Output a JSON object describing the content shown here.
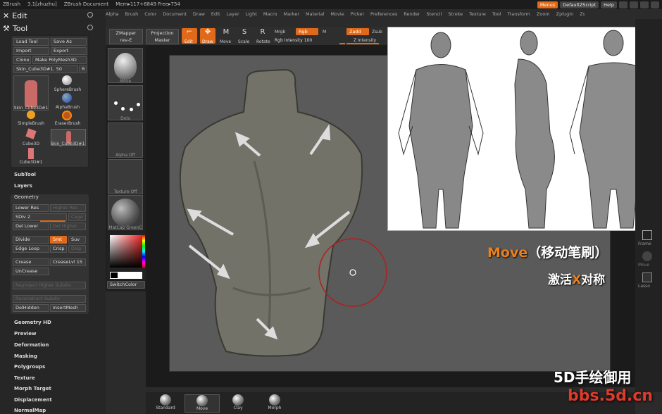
{
  "titlebar": {
    "app": "ZBrush",
    "version": "3.1[zhuzhu]",
    "doc": "ZBrush Document",
    "mem": "Mem▸117+6849 Free▸754"
  },
  "topright": {
    "menus": "Menus",
    "script": "DefaultZScript",
    "help": "Help"
  },
  "menubar": [
    "Alpha",
    "Brush",
    "Color",
    "Document",
    "Draw",
    "Edit",
    "Layer",
    "Light",
    "Macro",
    "Marker",
    "Material",
    "Movie",
    "Picker",
    "Preferences",
    "Render",
    "Stencil",
    "Stroke",
    "Texture",
    "Tool",
    "Transform",
    "Zoom",
    "Zplugin",
    "Zscript"
  ],
  "left": {
    "edit": "Edit",
    "tool": "Tool",
    "load_tool": "Load Tool",
    "save_as": "Save As",
    "import": "Import",
    "export": "Export",
    "clone": "Clone",
    "make_poly": "Make PolyMesh3D",
    "current": "Skin_Cube3D#1. 50",
    "r": "R",
    "thumbs": [
      "Skin_Cube3D#1",
      "SphereBrush",
      "AlphaBrush",
      "SimpleBrush",
      "EraserBrush",
      "Cube3D",
      "Skin_Cube3D#1",
      "Cube3D#1"
    ],
    "subtool": "SubTool",
    "layers": "Layers",
    "geometry": "Geometry",
    "lower_res": "Lower Res",
    "higher_res": "Higher Res",
    "sdiv": "SDiv 2",
    "cage": "Cage",
    "del_lower": "Del Lower",
    "del_higher": "Del Higher",
    "divide": "Divide",
    "smt": "Smt",
    "suv": "Suv",
    "edge_loop": "Edge Loop",
    "crisp": "Crisp",
    "disp": "Disp",
    "crease": "Crease",
    "crease_lvl": "CreaseLvl 15",
    "uncrease": "UnCrease",
    "reproject": "Reproject Higher Subdiv",
    "reconstruct": "Reconstruct Subdiv",
    "delhidden": "DelHidden",
    "insertmesh": "InsertMesh",
    "sections": [
      "Geometry HD",
      "Preview",
      "Deformation",
      "Masking",
      "Polygroups",
      "Texture",
      "Morph Target",
      "Displacement",
      "NormalMap"
    ]
  },
  "toolbar": {
    "zmapper": "ZMapper",
    "zmapper2": "rev-E",
    "projection": "Projection",
    "projection2": "Master",
    "edit": "Edit",
    "draw": "Draw",
    "move": "Move",
    "scale": "Scale",
    "rotate": "Rotate",
    "mrgb": "Mrgb",
    "rgb": "Rgb",
    "m": "M",
    "rgb_intensity": "Rgb Intensity 100",
    "zadd": "Zadd",
    "zsub": "Zsub",
    "z_intensity": "Z Intensity"
  },
  "shelf": [
    "Move",
    "Dots",
    "Alpha Off",
    "Texture Off",
    "MatCap GreenC"
  ],
  "switchcolor": "SwitchColor",
  "rightshelf": [
    "Frame",
    "Move",
    "Lasso"
  ],
  "bottom": [
    "Standard",
    "Move",
    "Clay",
    "Morph"
  ],
  "overlay": {
    "line1a": "Move",
    "line1b": "（移动笔刷）",
    "line2a": "激活",
    "line2b": "X",
    "line2c": "对称"
  },
  "watermark": {
    "line1": "5D手绘御用",
    "line2": "bbs.5d.cn"
  }
}
